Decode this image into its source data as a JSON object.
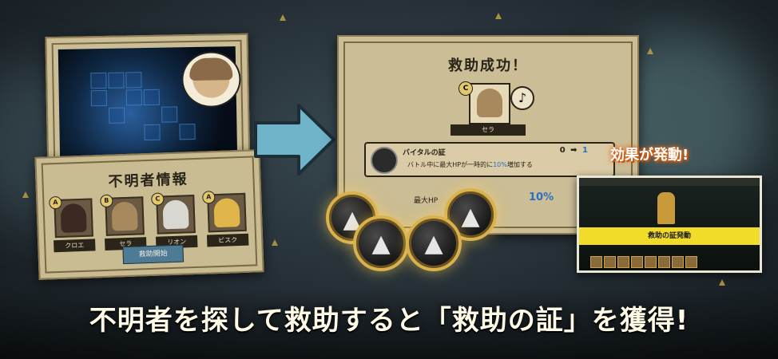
{
  "missing_panel": {
    "title": "不明者情報",
    "characters": [
      {
        "name": "クロエ",
        "rank": "A",
        "hair": "#3a2a22"
      },
      {
        "name": "セラ",
        "rank": "B",
        "hair": "#a8895e"
      },
      {
        "name": "リオン",
        "rank": "C",
        "hair": "#d8d8d0"
      },
      {
        "name": "ビスク",
        "rank": "A",
        "hair": "#e0b64a"
      }
    ],
    "rescue_button": "救助開始"
  },
  "result_panel": {
    "title": "救助成功！",
    "rank": "C",
    "character_name": "セラ",
    "effect_name": "バイタルの証",
    "level_from": "0",
    "level_to": "1",
    "effect_description_pre": "バトル中に最大HPが一時的に",
    "effect_description_value": "10%",
    "effect_description_post": "増加する",
    "stat_label": "最大HP",
    "stat_value": "10%"
  },
  "effect_banner": "効果が発動!",
  "game_shot": {
    "banner": "救助の証発動"
  },
  "caption": "不明者を探して救助すると「救助の証」を獲得!",
  "colors": {
    "accent_gold": "#d9b24e",
    "accent_blue": "#2a6fc2",
    "banner_yellow": "#f1dc2a"
  }
}
